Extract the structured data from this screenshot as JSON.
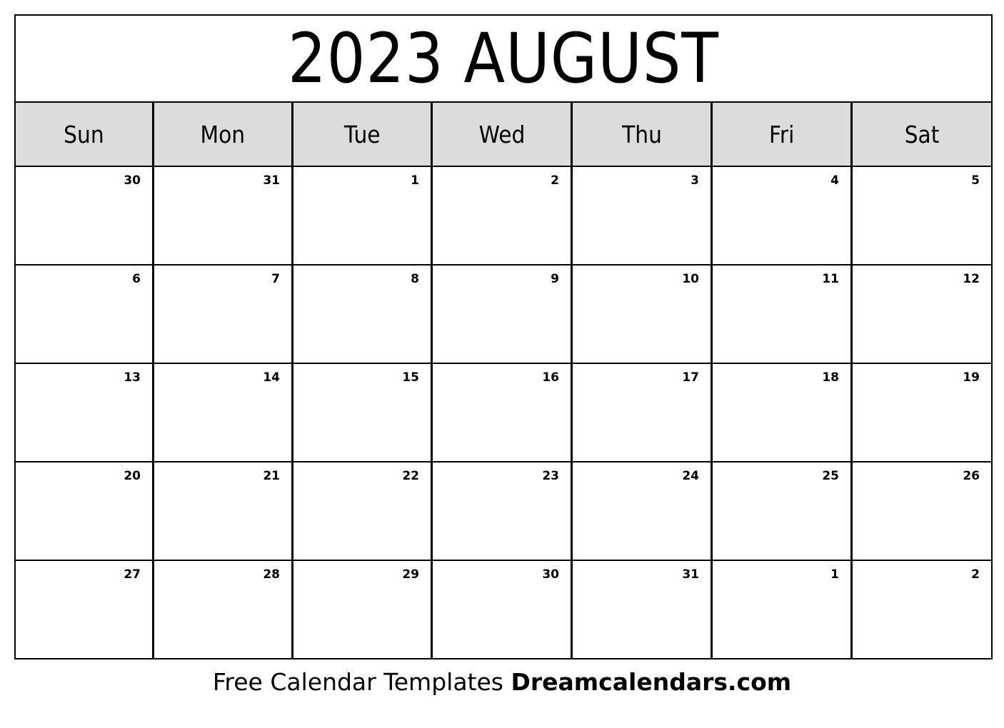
{
  "title": "2023 AUGUST",
  "weekdays": [
    "Sun",
    "Mon",
    "Tue",
    "Wed",
    "Thu",
    "Fri",
    "Sat"
  ],
  "weeks": [
    [
      "30",
      "31",
      "1",
      "2",
      "3",
      "4",
      "5"
    ],
    [
      "6",
      "7",
      "8",
      "9",
      "10",
      "11",
      "12"
    ],
    [
      "13",
      "14",
      "15",
      "16",
      "17",
      "18",
      "19"
    ],
    [
      "20",
      "21",
      "22",
      "23",
      "24",
      "25",
      "26"
    ],
    [
      "27",
      "28",
      "29",
      "30",
      "31",
      "1",
      "2"
    ]
  ],
  "footer": {
    "text": "Free Calendar Templates",
    "brand": "Dreamcalendars.com"
  }
}
